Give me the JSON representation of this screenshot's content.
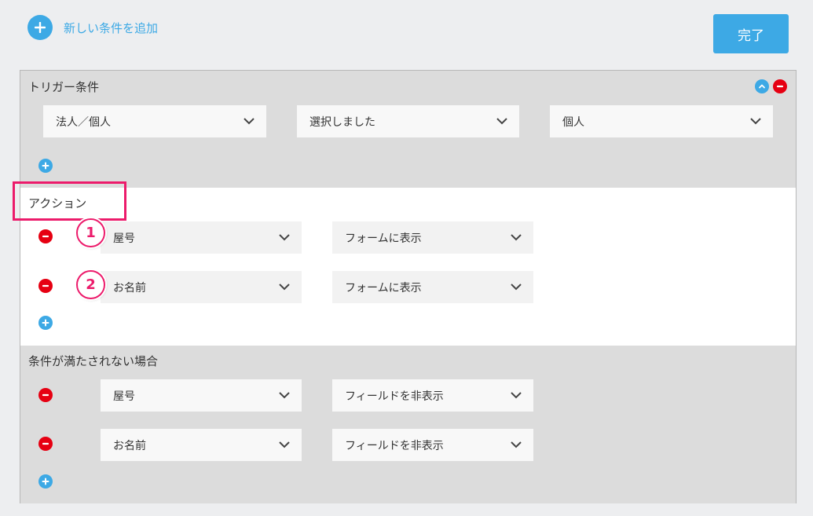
{
  "header": {
    "add_condition_label": "新しい条件を追加",
    "done_label": "完了"
  },
  "trigger": {
    "title": "トリガー条件",
    "selects": [
      "法人／個人",
      "選択しました",
      "個人"
    ]
  },
  "action": {
    "title": "アクション",
    "rows": [
      {
        "badge": "1",
        "field": "屋号",
        "operation": "フォームに表示"
      },
      {
        "badge": "2",
        "field": "お名前",
        "operation": "フォームに表示"
      }
    ]
  },
  "else": {
    "title": "条件が満たされない場合",
    "rows": [
      {
        "field": "屋号",
        "operation": "フィールドを非表示"
      },
      {
        "field": "お名前",
        "operation": "フィールドを非表示"
      }
    ]
  },
  "colors": {
    "accent": "#3da9e5",
    "remove": "#e60012",
    "highlight": "#ec1b6b"
  }
}
